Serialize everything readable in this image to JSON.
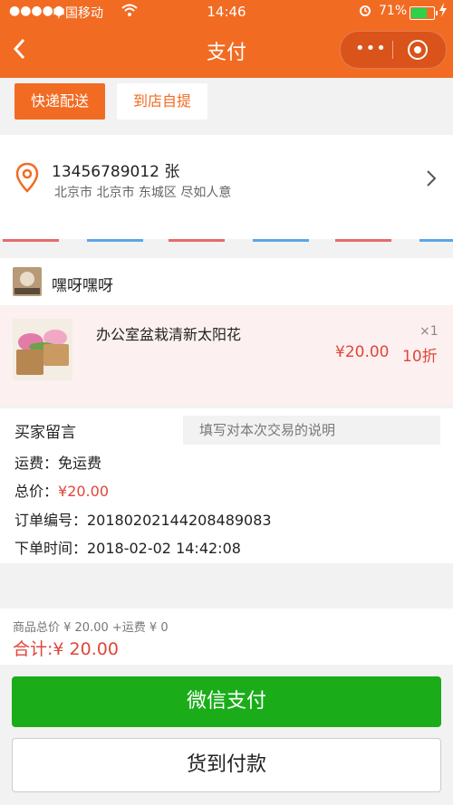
{
  "status_bar": {
    "signal": "●●●●●",
    "carrier": "中国移动",
    "time": "14:46",
    "battery": "71%"
  },
  "header": {
    "title": "支付",
    "back_icon": "chevron-left-icon",
    "menu_dots": "•••"
  },
  "delivery_tabs": [
    {
      "label": "快递配送",
      "selected": true
    },
    {
      "label": "到店自提",
      "selected": false
    }
  ],
  "address": {
    "name_phone": "13456789012 张",
    "detail": "北京市 北京市 东城区 尽如人意"
  },
  "shop": {
    "name": "嘿呀嘿呀"
  },
  "product": {
    "title": "办公室盆栽清新太阳花",
    "quantity": "×1",
    "price": "¥20.00",
    "discount": "10折"
  },
  "order_info": {
    "message_label": "买家留言",
    "message_placeholder": "填写对本次交易的说明",
    "shipping": "运费：免运费",
    "total_label": "总价：",
    "total_value": "¥20.00",
    "order_no": "订单编号：20180202144208489083",
    "order_time": "下单时间：2018-02-02 14:42:08"
  },
  "summary": {
    "line": "商品总价 ¥ 20.00 +运费 ¥ 0",
    "total": "合计:¥ 20.00"
  },
  "buttons": {
    "wechat_pay": "微信支付",
    "cash_on_delivery": "货到付款"
  },
  "colors": {
    "accent": "#f26b22",
    "price_red": "#e0463a",
    "wechat_green": "#1aad19"
  }
}
